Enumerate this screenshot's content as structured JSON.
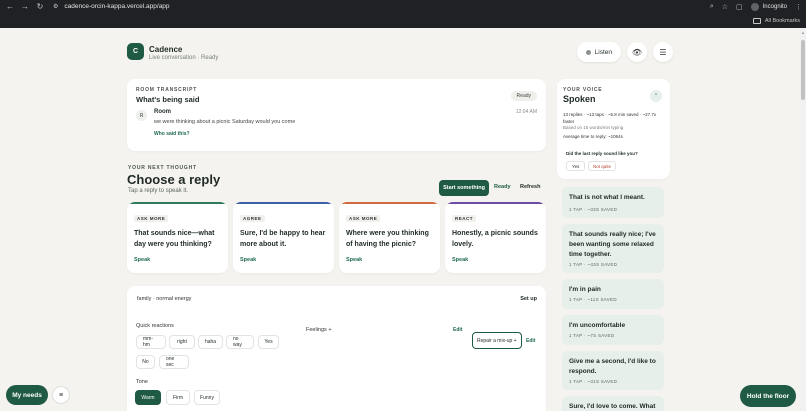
{
  "browser": {
    "url": "cadence-orcin-kappa.vercel.app/app",
    "profile": "Incognito",
    "bookmarks_label": "All Bookmarks"
  },
  "header": {
    "logo_letter": "C",
    "app_name": "Cadence",
    "status": "Live conversation · Ready",
    "listen_label": "Listen"
  },
  "transcript": {
    "eyebrow": "ROOM TRANSCRIPT",
    "title": "What's being said",
    "badge": "Ready",
    "message": {
      "avatar": "R",
      "speaker": "Room",
      "text": "we were thinking about a picnic Saturday would you come",
      "time": "12:04 AM"
    },
    "who_said_this": "Who said this?"
  },
  "next_thought": {
    "eyebrow": "YOUR NEXT THOUGHT",
    "title": "Choose a reply",
    "subtitle": "Tap a reply to speak it.",
    "start_label": "Start something",
    "ready_label": "Ready",
    "refresh_label": "Refresh"
  },
  "replies": [
    {
      "tag": "ASK MORE",
      "text": "That sounds nice—what day were you thinking?",
      "action": "Speak",
      "accent": "#2f7a5a"
    },
    {
      "tag": "AGREE",
      "text": "Sure, I'd be happy to hear more about it.",
      "action": "Speak",
      "accent": "#3b5fa8"
    },
    {
      "tag": "ASK MORE",
      "text": "Where were you thinking of having the picnic?",
      "action": "Speak",
      "accent": "#d06a3c"
    },
    {
      "tag": "REACT",
      "text": "Honestly, a picnic sounds lovely.",
      "action": "Speak",
      "accent": "#6b4ba3"
    }
  ],
  "quick_panel": {
    "context": "family · normal energy",
    "setup_label": "Set up",
    "quick_reactions_label": "Quick reactions",
    "feelings_label": "Feelings +",
    "edit_label": "Edit",
    "repair_label": "Repair a mix-up +",
    "repair_edit_label": "Edit",
    "reactions": [
      "mm-hm",
      "right",
      "haha",
      "no way",
      "Yes",
      "No",
      "one sec"
    ],
    "tone_label": "Tone",
    "tones": [
      "Warm",
      "Firm",
      "Funny"
    ],
    "active_tone": "Warm"
  },
  "voice": {
    "eyebrow": "YOUR VOICE",
    "title": "Spoken",
    "stats": "13 replies · ~13 taps · ~5.8 min saved · ~27.7x faster",
    "based_on": "Based on 15 words/min typing",
    "avg_time": "Average time to reply: ~1064s",
    "feedback_question": "Did the last reply sound like you?",
    "yes_label": "Yes",
    "no_label": "Not quite"
  },
  "phrases": [
    {
      "text": "That is not what I meant.",
      "meta": "1 TAP · ~33S SAVED"
    },
    {
      "text": "That sounds really nice; I've been wanting some relaxed time together.",
      "meta": "1 TAP · ~43S SAVED"
    },
    {
      "text": "I'm in pain",
      "meta": "1 TAP · ~11S SAVED"
    },
    {
      "text": "I'm uncomfortable",
      "meta": "1 TAP · ~7S SAVED"
    },
    {
      "text": "Give me a second, I'd like to respond.",
      "meta": "1 TAP · ~31S SAVED"
    },
    {
      "text": "Sure, I'd love to come. What",
      "meta": ""
    }
  ],
  "floating": {
    "my_needs": "My needs",
    "hold_floor": "Hold the floor"
  }
}
